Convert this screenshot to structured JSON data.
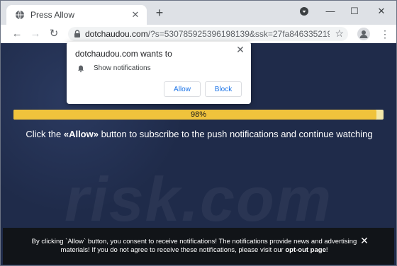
{
  "tab": {
    "title": "Press Allow",
    "favicon_icon": "globe-icon"
  },
  "toolbar": {
    "url_domain": "dotchaudou.com",
    "url_rest": "/?s=530785925396198139&ssk=27fa8463352193..."
  },
  "popup": {
    "title": "dotchaudou.com wants to",
    "permission": "Show notifications",
    "allow_label": "Allow",
    "block_label": "Block"
  },
  "page": {
    "progress_value": 98,
    "progress_label": "98%",
    "headline_prefix": "Click the ",
    "headline_bold": "«Allow»",
    "headline_suffix": " button to subscribe to the push notifications and continue watching",
    "watermark": "risk.com"
  },
  "notice": {
    "text": "By clicking `Allow` button, you consent to receive notifications! The notifications provide news and advertising materials! If you do not agree to receive these notifications, please visit our ",
    "link": "opt-out page",
    "end": "!"
  },
  "colors": {
    "page_bg": "#1f2b4a",
    "progress_fill": "#f0c33c",
    "notice_bg": "#111418"
  }
}
